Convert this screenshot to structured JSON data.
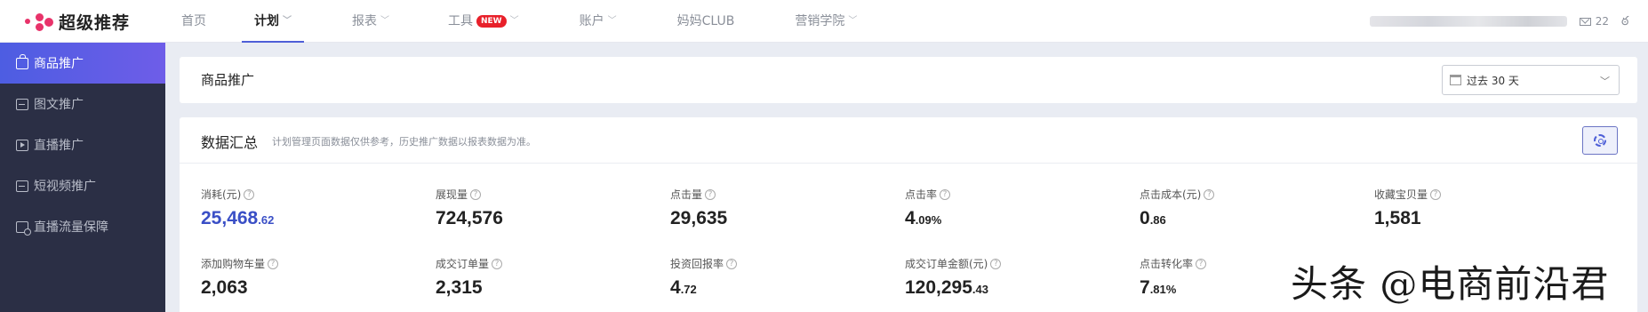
{
  "app": {
    "logo_text": "超级推荐"
  },
  "nav": {
    "items": [
      {
        "label": "首页",
        "chevron": false,
        "badge": ""
      },
      {
        "label": "计划",
        "chevron": true,
        "badge": ""
      },
      {
        "label": "报表",
        "chevron": true,
        "badge": ""
      },
      {
        "label": "工具",
        "chevron": true,
        "badge": "NEW"
      },
      {
        "label": "账户",
        "chevron": true,
        "badge": ""
      },
      {
        "label": "妈妈CLUB",
        "chevron": false,
        "badge": ""
      },
      {
        "label": "营销学院",
        "chevron": true,
        "badge": ""
      }
    ],
    "active_index": 1
  },
  "header_right": {
    "message_count": "22"
  },
  "sidebar": {
    "items": [
      {
        "label": "商品推广",
        "icon": "bag-icon"
      },
      {
        "label": "图文推广",
        "icon": "image-icon"
      },
      {
        "label": "直播推广",
        "icon": "live-icon"
      },
      {
        "label": "短视频推广",
        "icon": "video-icon"
      },
      {
        "label": "直播流量保障",
        "icon": "traffic-guarantee-icon"
      }
    ],
    "active_index": 0
  },
  "promo_card": {
    "title": "商品推广",
    "date_range": "过去 30 天"
  },
  "summary": {
    "title": "数据汇总",
    "note": "计划管理页面数据仅供参考，历史推广数据以报表数据为准。",
    "metrics": [
      {
        "label": "消耗(元)",
        "int": "25,468",
        "dec": ".62",
        "primary": true
      },
      {
        "label": "展现量",
        "int": "724,576",
        "dec": ""
      },
      {
        "label": "点击量",
        "int": "29,635",
        "dec": ""
      },
      {
        "label": "点击率",
        "int": "4",
        "dec": ".09%"
      },
      {
        "label": "点击成本(元)",
        "int": "0",
        "dec": ".86"
      },
      {
        "label": "收藏宝贝量",
        "int": "1,581",
        "dec": ""
      },
      {
        "label": "添加购物车量",
        "int": "2,063",
        "dec": ""
      },
      {
        "label": "成交订单量",
        "int": "2,315",
        "dec": ""
      },
      {
        "label": "投资回报率",
        "int": "4",
        "dec": ".72"
      },
      {
        "label": "成交订单金额(元)",
        "int": "120,295",
        "dec": ".43"
      },
      {
        "label": "点击转化率",
        "int": "7",
        "dec": ".81%"
      }
    ]
  },
  "watermark": "头条 @电商前沿君"
}
